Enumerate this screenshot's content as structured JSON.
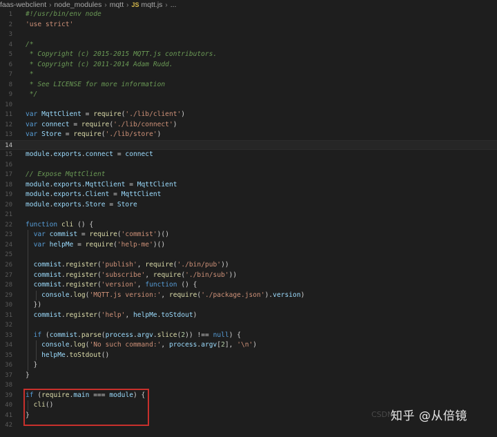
{
  "breadcrumb": {
    "items": [
      "faas-webclient",
      "node_modules",
      "mqtt"
    ],
    "file_badge": "JS",
    "file_name": "mqtt.js",
    "ellipsis": "..."
  },
  "editor": {
    "active_line": 14,
    "lines": [
      {
        "n": "1",
        "tokens": [
          [
            "comment",
            "#!/usr/bin/env node"
          ]
        ]
      },
      {
        "n": "2",
        "tokens": [
          [
            "str",
            "'use strict'"
          ]
        ]
      },
      {
        "n": "3",
        "tokens": []
      },
      {
        "n": "4",
        "tokens": [
          [
            "comment",
            "/*"
          ]
        ]
      },
      {
        "n": "5",
        "tokens": [
          [
            "comment",
            " * Copyright (c) 2015-2015 MQTT.js contributors."
          ]
        ]
      },
      {
        "n": "6",
        "tokens": [
          [
            "comment",
            " * Copyright (c) 2011-2014 Adam Rudd."
          ]
        ]
      },
      {
        "n": "7",
        "tokens": [
          [
            "comment",
            " *"
          ]
        ]
      },
      {
        "n": "8",
        "tokens": [
          [
            "comment",
            " * See LICENSE for more information"
          ]
        ]
      },
      {
        "n": "9",
        "tokens": [
          [
            "comment",
            " */"
          ]
        ]
      },
      {
        "n": "10",
        "tokens": []
      },
      {
        "n": "11",
        "tokens": [
          [
            "kw",
            "var "
          ],
          [
            "var",
            "MqttClient"
          ],
          [
            "plain",
            " = "
          ],
          [
            "fn",
            "require"
          ],
          [
            "plain",
            "("
          ],
          [
            "str",
            "'./lib/client'"
          ],
          [
            "plain",
            ")"
          ]
        ]
      },
      {
        "n": "12",
        "tokens": [
          [
            "kw",
            "var "
          ],
          [
            "var",
            "connect"
          ],
          [
            "plain",
            " = "
          ],
          [
            "fn",
            "require"
          ],
          [
            "plain",
            "("
          ],
          [
            "str",
            "'./lib/connect'"
          ],
          [
            "plain",
            ")"
          ]
        ]
      },
      {
        "n": "13",
        "tokens": [
          [
            "kw",
            "var "
          ],
          [
            "var",
            "Store"
          ],
          [
            "plain",
            " = "
          ],
          [
            "fn",
            "require"
          ],
          [
            "plain",
            "("
          ],
          [
            "str",
            "'./lib/store'"
          ],
          [
            "plain",
            ")"
          ]
        ]
      },
      {
        "n": "14",
        "tokens": []
      },
      {
        "n": "15",
        "tokens": [
          [
            "var",
            "module"
          ],
          [
            "plain",
            "."
          ],
          [
            "var",
            "exports"
          ],
          [
            "plain",
            "."
          ],
          [
            "var",
            "connect"
          ],
          [
            "plain",
            " = "
          ],
          [
            "var",
            "connect"
          ]
        ]
      },
      {
        "n": "16",
        "tokens": []
      },
      {
        "n": "17",
        "tokens": [
          [
            "comment",
            "// Expose MqttClient"
          ]
        ]
      },
      {
        "n": "18",
        "tokens": [
          [
            "var",
            "module"
          ],
          [
            "plain",
            "."
          ],
          [
            "var",
            "exports"
          ],
          [
            "plain",
            "."
          ],
          [
            "var",
            "MqttClient"
          ],
          [
            "plain",
            " = "
          ],
          [
            "var",
            "MqttClient"
          ]
        ]
      },
      {
        "n": "19",
        "tokens": [
          [
            "var",
            "module"
          ],
          [
            "plain",
            "."
          ],
          [
            "var",
            "exports"
          ],
          [
            "plain",
            "."
          ],
          [
            "var",
            "Client"
          ],
          [
            "plain",
            " = "
          ],
          [
            "var",
            "MqttClient"
          ]
        ]
      },
      {
        "n": "20",
        "tokens": [
          [
            "var",
            "module"
          ],
          [
            "plain",
            "."
          ],
          [
            "var",
            "exports"
          ],
          [
            "plain",
            "."
          ],
          [
            "var",
            "Store"
          ],
          [
            "plain",
            " = "
          ],
          [
            "var",
            "Store"
          ]
        ]
      },
      {
        "n": "21",
        "tokens": []
      },
      {
        "n": "22",
        "tokens": [
          [
            "kw",
            "function "
          ],
          [
            "fn",
            "cli"
          ],
          [
            "plain",
            " () {"
          ]
        ]
      },
      {
        "n": "23",
        "tokens": [
          [
            "plain",
            "  "
          ],
          [
            "kw",
            "var "
          ],
          [
            "var",
            "commist"
          ],
          [
            "plain",
            " = "
          ],
          [
            "fn",
            "require"
          ],
          [
            "plain",
            "("
          ],
          [
            "str",
            "'commist'"
          ],
          [
            "plain",
            ")()"
          ]
        ]
      },
      {
        "n": "24",
        "tokens": [
          [
            "plain",
            "  "
          ],
          [
            "kw",
            "var "
          ],
          [
            "var",
            "helpMe"
          ],
          [
            "plain",
            " = "
          ],
          [
            "fn",
            "require"
          ],
          [
            "plain",
            "("
          ],
          [
            "str",
            "'help-me'"
          ],
          [
            "plain",
            ")()"
          ]
        ]
      },
      {
        "n": "25",
        "tokens": []
      },
      {
        "n": "26",
        "tokens": [
          [
            "plain",
            "  "
          ],
          [
            "var",
            "commist"
          ],
          [
            "plain",
            "."
          ],
          [
            "fn",
            "register"
          ],
          [
            "plain",
            "("
          ],
          [
            "str",
            "'publish'"
          ],
          [
            "plain",
            ", "
          ],
          [
            "fn",
            "require"
          ],
          [
            "plain",
            "("
          ],
          [
            "str",
            "'./bin/pub'"
          ],
          [
            "plain",
            "))"
          ]
        ]
      },
      {
        "n": "27",
        "tokens": [
          [
            "plain",
            "  "
          ],
          [
            "var",
            "commist"
          ],
          [
            "plain",
            "."
          ],
          [
            "fn",
            "register"
          ],
          [
            "plain",
            "("
          ],
          [
            "str",
            "'subscribe'"
          ],
          [
            "plain",
            ", "
          ],
          [
            "fn",
            "require"
          ],
          [
            "plain",
            "("
          ],
          [
            "str",
            "'./bin/sub'"
          ],
          [
            "plain",
            "))"
          ]
        ]
      },
      {
        "n": "28",
        "tokens": [
          [
            "plain",
            "  "
          ],
          [
            "var",
            "commist"
          ],
          [
            "plain",
            "."
          ],
          [
            "fn",
            "register"
          ],
          [
            "plain",
            "("
          ],
          [
            "str",
            "'version'"
          ],
          [
            "plain",
            ", "
          ],
          [
            "kw",
            "function"
          ],
          [
            "plain",
            " () {"
          ]
        ]
      },
      {
        "n": "29",
        "tokens": [
          [
            "plain",
            "    "
          ],
          [
            "var",
            "console"
          ],
          [
            "plain",
            "."
          ],
          [
            "fn",
            "log"
          ],
          [
            "plain",
            "("
          ],
          [
            "str",
            "'MQTT.js version:'"
          ],
          [
            "plain",
            ", "
          ],
          [
            "fn",
            "require"
          ],
          [
            "plain",
            "("
          ],
          [
            "str",
            "'./package.json'"
          ],
          [
            "plain",
            ")."
          ],
          [
            "var",
            "version"
          ],
          [
            "plain",
            ")"
          ]
        ]
      },
      {
        "n": "30",
        "tokens": [
          [
            "plain",
            "  })"
          ]
        ]
      },
      {
        "n": "31",
        "tokens": [
          [
            "plain",
            "  "
          ],
          [
            "var",
            "commist"
          ],
          [
            "plain",
            "."
          ],
          [
            "fn",
            "register"
          ],
          [
            "plain",
            "("
          ],
          [
            "str",
            "'help'"
          ],
          [
            "plain",
            ", "
          ],
          [
            "var",
            "helpMe"
          ],
          [
            "plain",
            "."
          ],
          [
            "var",
            "toStdout"
          ],
          [
            "plain",
            ")"
          ]
        ]
      },
      {
        "n": "32",
        "tokens": []
      },
      {
        "n": "33",
        "tokens": [
          [
            "plain",
            "  "
          ],
          [
            "kw",
            "if"
          ],
          [
            "plain",
            " ("
          ],
          [
            "var",
            "commist"
          ],
          [
            "plain",
            "."
          ],
          [
            "fn",
            "parse"
          ],
          [
            "plain",
            "("
          ],
          [
            "var",
            "process"
          ],
          [
            "plain",
            "."
          ],
          [
            "var",
            "argv"
          ],
          [
            "plain",
            "."
          ],
          [
            "fn",
            "slice"
          ],
          [
            "plain",
            "("
          ],
          [
            "num",
            "2"
          ],
          [
            "plain",
            ")) !== "
          ],
          [
            "kw",
            "null"
          ],
          [
            "plain",
            ") {"
          ]
        ]
      },
      {
        "n": "34",
        "tokens": [
          [
            "plain",
            "    "
          ],
          [
            "var",
            "console"
          ],
          [
            "plain",
            "."
          ],
          [
            "fn",
            "log"
          ],
          [
            "plain",
            "("
          ],
          [
            "str",
            "'No such command:'"
          ],
          [
            "plain",
            ", "
          ],
          [
            "var",
            "process"
          ],
          [
            "plain",
            "."
          ],
          [
            "var",
            "argv"
          ],
          [
            "plain",
            "["
          ],
          [
            "num",
            "2"
          ],
          [
            "plain",
            "], "
          ],
          [
            "str",
            "'\\n'"
          ],
          [
            "plain",
            ")"
          ]
        ]
      },
      {
        "n": "35",
        "tokens": [
          [
            "plain",
            "    "
          ],
          [
            "var",
            "helpMe"
          ],
          [
            "plain",
            "."
          ],
          [
            "fn",
            "toStdout"
          ],
          [
            "plain",
            "()"
          ]
        ]
      },
      {
        "n": "36",
        "tokens": [
          [
            "plain",
            "  }"
          ]
        ]
      },
      {
        "n": "37",
        "tokens": [
          [
            "plain",
            "}"
          ]
        ]
      },
      {
        "n": "38",
        "tokens": []
      },
      {
        "n": "39",
        "tokens": [
          [
            "kw",
            "if"
          ],
          [
            "plain",
            " ("
          ],
          [
            "fn",
            "require"
          ],
          [
            "plain",
            "."
          ],
          [
            "var",
            "main"
          ],
          [
            "plain",
            " === "
          ],
          [
            "var",
            "module"
          ],
          [
            "plain",
            ") {"
          ]
        ]
      },
      {
        "n": "40",
        "tokens": [
          [
            "plain",
            "  "
          ],
          [
            "fn",
            "cli"
          ],
          [
            "plain",
            "()"
          ]
        ]
      },
      {
        "n": "41",
        "tokens": [
          [
            "plain",
            "}"
          ]
        ]
      },
      {
        "n": "42",
        "tokens": []
      }
    ]
  },
  "watermark": {
    "text": "知乎 @从倍镜",
    "ghost": "CSDN"
  },
  "colors": {
    "background": "#1e1e1e",
    "highlight_box": "#c9302c"
  }
}
